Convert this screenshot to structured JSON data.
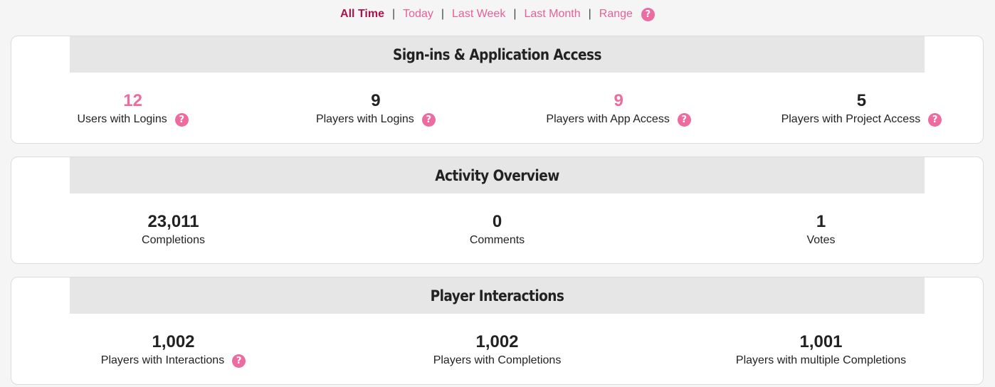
{
  "filters": {
    "items": [
      {
        "label": "All Time"
      },
      {
        "label": "Today"
      },
      {
        "label": "Last Week"
      },
      {
        "label": "Last Month"
      },
      {
        "label": "Range"
      }
    ],
    "separator": "|",
    "help_glyph": "?"
  },
  "sections": {
    "signins": {
      "title": "Sign-ins & Application Access",
      "stats": [
        {
          "value": "12",
          "label": "Users with Logins"
        },
        {
          "value": "9",
          "label": "Players with Logins"
        },
        {
          "value": "9",
          "label": "Players with App Access"
        },
        {
          "value": "5",
          "label": "Players with Project Access"
        }
      ]
    },
    "activity": {
      "title": "Activity Overview",
      "stats": [
        {
          "value": "23,011",
          "label": "Completions"
        },
        {
          "value": "0",
          "label": "Comments"
        },
        {
          "value": "1",
          "label": "Votes"
        }
      ]
    },
    "interactions": {
      "title": "Player Interactions",
      "stats": [
        {
          "value": "1,002",
          "label": "Players with Interactions"
        },
        {
          "value": "1,002",
          "label": "Players with Completions"
        },
        {
          "value": "1,001",
          "label": "Players with multiple Completions"
        }
      ]
    }
  },
  "colors": {
    "accent": "#ec6ba0",
    "active_filter": "#a8154e",
    "header_bg": "#e6e6e6"
  },
  "icons": {
    "help": "question-circle-icon"
  }
}
